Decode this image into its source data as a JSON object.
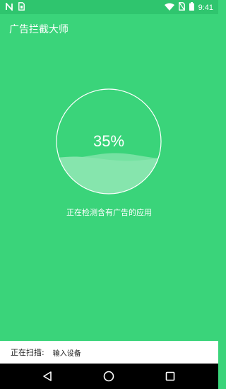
{
  "status_bar": {
    "time": "9:41",
    "icons": [
      "notification-n-icon",
      "sim-card-icon",
      "wifi-icon",
      "no-sim-icon",
      "battery-icon"
    ]
  },
  "app": {
    "title": "广告拦截大师"
  },
  "progress": {
    "percent_text": "35%",
    "value": 0.35,
    "status_text": "正在检测含有广告的应用"
  },
  "scan": {
    "label": "正在扫描:",
    "target": "输入设备"
  },
  "nav": {
    "icons": [
      "back-icon",
      "home-icon",
      "recents-icon"
    ]
  },
  "colors": {
    "background": "#3ad47a",
    "status_bar": "#2fc56e",
    "wave": "#7fe3a6"
  }
}
